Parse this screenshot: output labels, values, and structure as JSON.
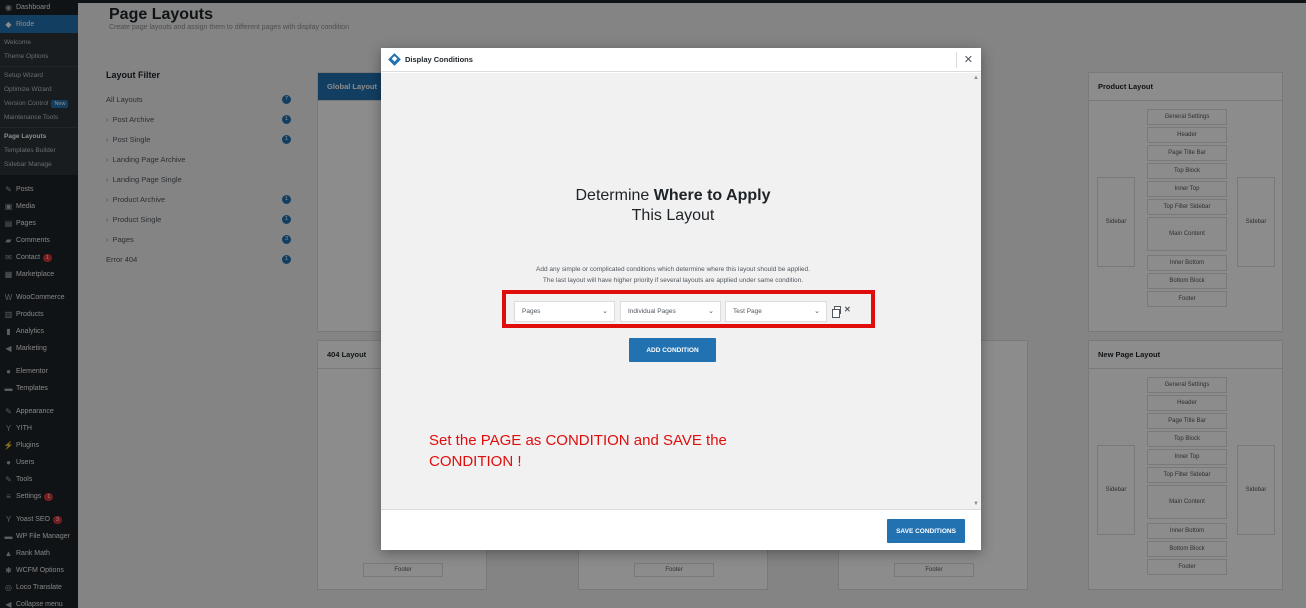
{
  "sidebar": {
    "dashboard": "Dashboard",
    "active": "Riode",
    "sub1": [
      "Welcome",
      "Theme Options"
    ],
    "sub2": [
      "Setup Wizard",
      "Optimize Wizard",
      "Version Control",
      "Maintenance Tools"
    ],
    "version_badge": "New",
    "sub3": [
      "Page Layouts",
      "Templates Builder",
      "Sidebar Manage"
    ],
    "items": [
      {
        "label": "Posts",
        "icon": "pin-icon"
      },
      {
        "label": "Media",
        "icon": "media-icon"
      },
      {
        "label": "Pages",
        "icon": "page-icon"
      },
      {
        "label": "Comments",
        "icon": "comment-icon"
      },
      {
        "label": "Contact",
        "icon": "mail-icon",
        "badge": "1"
      },
      {
        "label": "Marketplace",
        "icon": "store-icon"
      },
      {
        "label": "WooCommerce",
        "icon": "woo-icon"
      },
      {
        "label": "Products",
        "icon": "box-icon"
      },
      {
        "label": "Analytics",
        "icon": "bar-chart-icon"
      },
      {
        "label": "Marketing",
        "icon": "megaphone-icon"
      },
      {
        "label": "Elementor",
        "icon": "elementor-icon"
      },
      {
        "label": "Templates",
        "icon": "folder-icon"
      },
      {
        "label": "Appearance",
        "icon": "brush-icon"
      },
      {
        "label": "YITH",
        "icon": "yith-icon"
      },
      {
        "label": "Plugins",
        "icon": "plug-icon"
      },
      {
        "label": "Users",
        "icon": "user-icon"
      },
      {
        "label": "Tools",
        "icon": "wrench-icon"
      },
      {
        "label": "Settings",
        "icon": "settings-icon",
        "badge": "1"
      },
      {
        "label": "Yoast SEO",
        "icon": "yoast-icon",
        "badge": "3"
      },
      {
        "label": "WP File Manager",
        "icon": "folder-icon"
      },
      {
        "label": "Rank Math",
        "icon": "rank-icon"
      },
      {
        "label": "WCFM Options",
        "icon": "gear-icon"
      },
      {
        "label": "Loco Translate",
        "icon": "globe-icon"
      },
      {
        "label": "Collapse menu",
        "icon": "collapse-icon"
      }
    ]
  },
  "page": {
    "title": "Page Layouts",
    "subtitle": "Create page layouts and assign them to different pages with display condition"
  },
  "filter": {
    "title": "Layout Filter",
    "items": [
      {
        "label": "All Layouts",
        "count": "7"
      },
      {
        "label": "Post Archive",
        "count": "1"
      },
      {
        "label": "Post Single",
        "count": "1"
      },
      {
        "label": "Landing Page Archive",
        "count": ""
      },
      {
        "label": "Landing Page Single",
        "count": ""
      },
      {
        "label": "Product Archive",
        "count": "1"
      },
      {
        "label": "Product Single",
        "count": "1"
      },
      {
        "label": "Pages",
        "count": "3"
      },
      {
        "label": "Error 404",
        "count": "1"
      }
    ]
  },
  "cards": {
    "global": "Global Layout",
    "product": "Product Layout",
    "notfound": "404 Layout",
    "newpage": "New Page Layout",
    "blocks": [
      "General Settings",
      "Header",
      "Page Title Bar",
      "Top Block",
      "Inner Top",
      "Top Filter Sidebar",
      "Main Content",
      "Inner Bottom",
      "Bottom Block",
      "Footer"
    ],
    "sidebar_label": "Sidebar"
  },
  "modal": {
    "title": "Display Conditions",
    "heading_plain": "Determine ",
    "heading_bold": "Where to Apply",
    "heading_line2": "This Layout",
    "desc_line1": "Add any simple or complicated conditions which determine where this layout should be applied.",
    "desc_line2": "The last layout will have higher priority if several layouts are applied under same condition.",
    "condition": {
      "type": "Pages",
      "scope": "Individual Pages",
      "value": "Test Page"
    },
    "add_button": "ADD CONDITION",
    "save_button": "SAVE CONDITIONS"
  },
  "annotation": "Set the PAGE as CONDITION and SAVE the CONDITION !"
}
